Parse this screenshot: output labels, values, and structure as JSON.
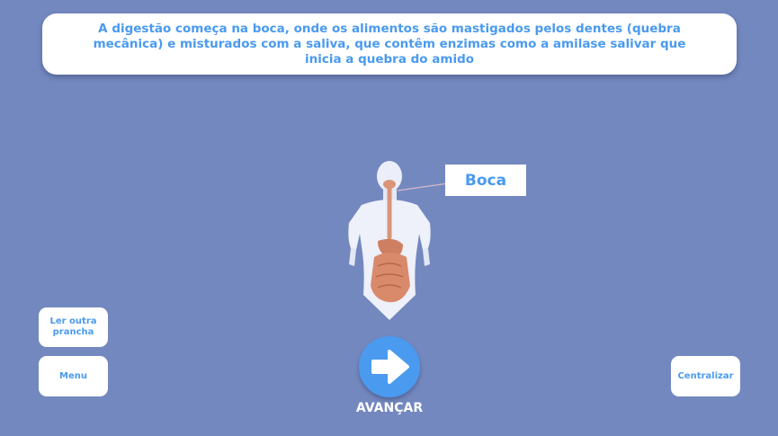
{
  "info_panel": {
    "text": "A digestão começa na boca, onde os alimentos são mastigados pelos dentes (quebra mecânica) e misturados com a saliva, que contêm enzimas como a amilase salivar que inicia a quebra do amido"
  },
  "organ_label": {
    "text": "Boca"
  },
  "buttons": {
    "other_board": "Ler outra prancha",
    "menu": "Menu",
    "center": "Centralizar",
    "advance": "AVANÇAR"
  },
  "icons": {
    "advance": "arrow-right-icon"
  },
  "colors": {
    "background": "#7388bf",
    "accent": "#4a9af0",
    "panel": "#ffffff"
  }
}
